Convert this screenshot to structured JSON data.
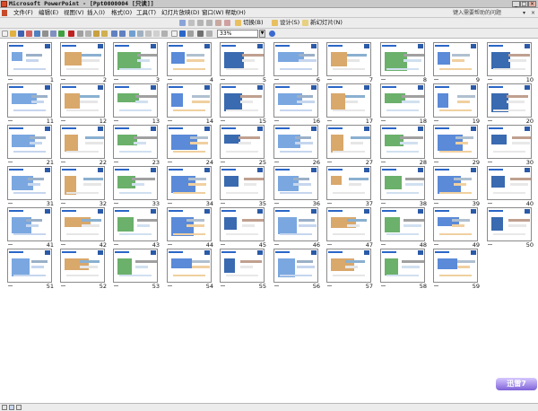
{
  "window": {
    "title": "Microsoft PowerPoint - [Ppt0000004 [只读]]",
    "minimize": "_",
    "maximize": "□",
    "close": "×"
  },
  "menubar": {
    "items": [
      {
        "label": "文件(F)",
        "name": "menu-file"
      },
      {
        "label": "编辑(E)",
        "name": "menu-edit"
      },
      {
        "label": "视图(V)",
        "name": "menu-view"
      },
      {
        "label": "插入(I)",
        "name": "menu-insert"
      },
      {
        "label": "格式(O)",
        "name": "menu-format"
      },
      {
        "label": "工具(T)",
        "name": "menu-tools"
      },
      {
        "label": "幻灯片放映(D)",
        "name": "menu-slideshow"
      },
      {
        "label": "窗口(W)",
        "name": "menu-window"
      },
      {
        "label": "帮助(H)",
        "name": "menu-help"
      }
    ],
    "help_placeholder": "键入需要帮助的问题"
  },
  "toolbar": {
    "switch_label": "切换(B)",
    "design_label": "设计(S)",
    "new_slide_label": "新幻灯片(N)",
    "zoom_value": "33%"
  },
  "slides": [
    "1",
    "2",
    "3",
    "4",
    "5",
    "6",
    "7",
    "8",
    "9",
    "10",
    "11",
    "12",
    "13",
    "14",
    "15",
    "16",
    "17",
    "18",
    "19",
    "20",
    "21",
    "22",
    "23",
    "24",
    "25",
    "26",
    "27",
    "28",
    "29",
    "30",
    "31",
    "32",
    "33",
    "34",
    "35",
    "36",
    "37",
    "38",
    "39",
    "40",
    "41",
    "42",
    "43",
    "44",
    "45",
    "46",
    "47",
    "48",
    "49",
    "50",
    "51",
    "52",
    "53",
    "54",
    "55",
    "56",
    "57",
    "58",
    "59"
  ],
  "brand": {
    "label": "迅雷7"
  },
  "colors": {
    "accent": "#2a66c8",
    "brand": "#7f62d8"
  }
}
